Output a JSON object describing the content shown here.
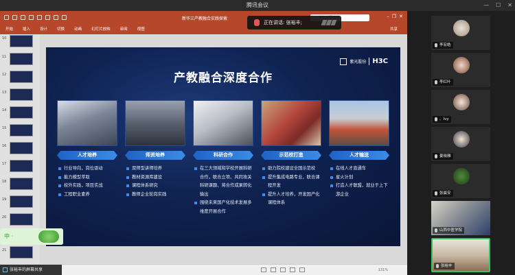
{
  "window": {
    "title": "腾讯会议"
  },
  "ppt": {
    "file_title": "新华三产教融合实践探索",
    "search_placeholder": "操作说明搜索",
    "tabs": [
      "开始",
      "插入",
      "设计",
      "切换",
      "动画",
      "幻灯片放映",
      "审阅",
      "视图"
    ],
    "share_label": "共享",
    "thumbnail_numbers": [
      "10",
      "11",
      "12",
      "13",
      "14",
      "15",
      "16",
      "17",
      "18",
      "19",
      "20",
      "21"
    ],
    "status_zoom": "131%"
  },
  "speaker": {
    "label": "正在讲话: 张裕丰;"
  },
  "slide": {
    "title": "产教融合深度合作",
    "logo_text": "紫光股份",
    "logo_brand": "H3C",
    "columns": [
      {
        "heading": "人才培养",
        "bullets": [
          "行业导向，岗位驱动",
          "能力模型萃取",
          "校外实践，项目实战",
          "工程职业素养"
        ]
      },
      {
        "heading": "师资培养",
        "bullets": [
          "双师型讲师培养",
          "教材资源库建设",
          "课程体系研究",
          "教师企业轮岗实践"
        ]
      },
      {
        "heading": "科研合作",
        "bullets": [
          "在三大领域和学校开展科研合作，联合立项、共同攻关科研课题、将合作成果转化输出",
          "围绕未来国产化技术发展多维度开展合作"
        ]
      },
      {
        "heading": "示范校打造",
        "bullets": [
          "助力院校建设全国示范校",
          "提升集成电路专业，联合课程开发",
          "提升人才培养，开发国产化课程体系"
        ]
      },
      {
        "heading": "人才输送",
        "bullets": [
          "在线人才直通车",
          "星火计划",
          "打造人才联盟，就业于上下游企业"
        ]
      }
    ]
  },
  "share_status": {
    "label": "张裕丰的屏幕共享"
  },
  "widget": {
    "text": "中 ·  "
  },
  "participants": [
    {
      "name": "李宏皓"
    },
    {
      "name": "李红叶"
    },
    {
      "name": "、Ivy"
    },
    {
      "name": "姜晓雅"
    },
    {
      "name": "张晨安"
    },
    {
      "name": "山西中医学院"
    },
    {
      "name": "张裕丰"
    }
  ],
  "colors": {
    "ppt_red": "#b7472a",
    "slide_bg": "#0f2250",
    "banner_blue": "#2f7ad8",
    "active_tile": "#37c45c"
  }
}
